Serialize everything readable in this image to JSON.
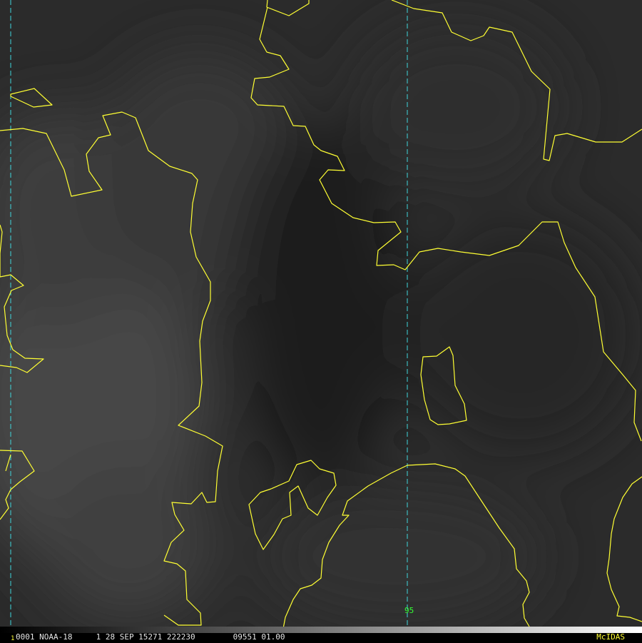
{
  "image": {
    "frame_number": "1",
    "header_text": "0001 NOAA-18     1 28 SEP 15271 222230        09551 01.00",
    "brand": "McIDAS",
    "longitude_label": "95"
  },
  "colors": {
    "coastline": "#ffff33",
    "meridian": "#3fd6dc",
    "longitude_label": "#33ff33",
    "brand": "#ffff33",
    "background": "#2a2a2a"
  }
}
